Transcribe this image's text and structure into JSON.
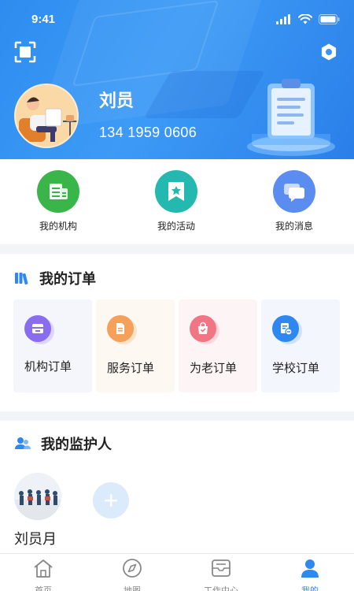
{
  "status_bar": {
    "time": "9:41"
  },
  "profile": {
    "name": "刘员",
    "phone": "134 1959 0606"
  },
  "quick_menu": [
    {
      "label": "我的机构",
      "icon": "institution-icon",
      "color": "#3ab54a"
    },
    {
      "label": "我的活动",
      "icon": "bookmark-star-icon",
      "color": "#23b8b0"
    },
    {
      "label": "我的消息",
      "icon": "message-icon",
      "color": "#5b8df0"
    }
  ],
  "orders": {
    "title": "我的订单",
    "items": [
      {
        "label": "机构订单",
        "icon": "institution-order-icon"
      },
      {
        "label": "服务订单",
        "icon": "service-order-icon"
      },
      {
        "label": "为老订单",
        "icon": "elderly-order-icon"
      },
      {
        "label": "学校订单",
        "icon": "school-order-icon"
      }
    ]
  },
  "guardians": {
    "title": "我的监护人",
    "list": [
      {
        "name": "刘员月"
      }
    ],
    "add_icon": "plus-icon"
  },
  "tab_bar": {
    "active": 3,
    "tabs": [
      {
        "label": "首页",
        "icon": "home-icon"
      },
      {
        "label": "地图",
        "icon": "compass-icon"
      },
      {
        "label": "工作中心",
        "icon": "inbox-icon"
      },
      {
        "label": "我的",
        "icon": "user-icon"
      }
    ]
  },
  "colors": {
    "header_blue": "#3d9bf6",
    "accent_blue": "#2f87f0",
    "tab_inactive": "#888888"
  }
}
